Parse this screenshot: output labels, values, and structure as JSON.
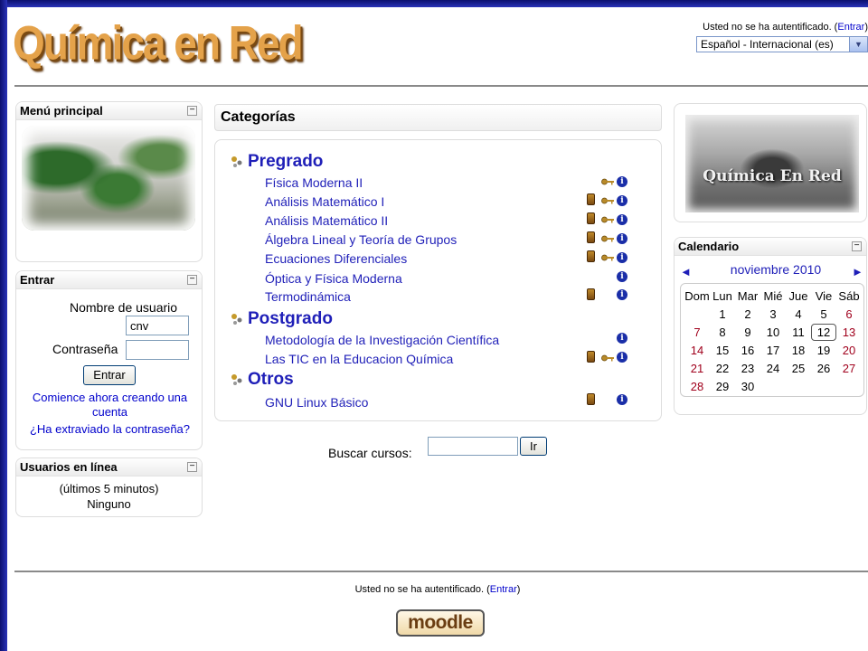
{
  "site": {
    "logo_text": "Química en Red"
  },
  "header": {
    "login_prefix": "Usted no se ha autentificado. (",
    "login_link": "Entrar",
    "login_suffix": ")",
    "language_selected": "Español - Internacional (es)"
  },
  "main_menu": {
    "title": "Menú principal"
  },
  "login_block": {
    "title": "Entrar",
    "username_label": "Nombre de usuario",
    "username_value": "cnv",
    "password_label": "Contraseña",
    "submit_label": "Entrar",
    "signup_link": "Comience ahora creando una cuenta",
    "forgot_link": "¿Ha extraviado la contraseña?"
  },
  "online_users": {
    "title": "Usuarios en línea",
    "period": "(últimos 5 minutos)",
    "value": "Ninguno"
  },
  "categories": {
    "heading": "Categorías",
    "groups": [
      {
        "name": "Pregrado",
        "courses": [
          {
            "name": "Física Moderna II",
            "guest": false,
            "key": true,
            "info": true
          },
          {
            "name": "Análisis Matemático I",
            "guest": true,
            "key": true,
            "info": true
          },
          {
            "name": "Análisis Matemático II",
            "guest": true,
            "key": true,
            "info": true
          },
          {
            "name": "Álgebra Lineal y Teoría de Grupos",
            "guest": true,
            "key": true,
            "info": true
          },
          {
            "name": "Ecuaciones Diferenciales",
            "guest": true,
            "key": true,
            "info": true
          },
          {
            "name": "Óptica y Física Moderna",
            "guest": false,
            "key": false,
            "info": true
          },
          {
            "name": "Termodinámica",
            "guest": true,
            "key": false,
            "info": true
          }
        ]
      },
      {
        "name": "Postgrado",
        "courses": [
          {
            "name": "Metodología de la Investigación Científica",
            "guest": false,
            "key": false,
            "info": true
          },
          {
            "name": "Las TIC en la Educacion Química",
            "guest": true,
            "key": true,
            "info": true
          }
        ]
      },
      {
        "name": "Otros",
        "courses": [
          {
            "name": "GNU Linux Básico",
            "guest": true,
            "key": false,
            "info": true
          }
        ]
      }
    ]
  },
  "search": {
    "label": "Buscar cursos:",
    "value": "",
    "button": "Ir"
  },
  "banner": {
    "text": "Química En Red"
  },
  "calendar": {
    "title": "Calendario",
    "month": "noviembre 2010",
    "prev": "◄",
    "next": "►",
    "weekdays": [
      "Dom",
      "Lun",
      "Mar",
      "Mié",
      "Jue",
      "Vie",
      "Sáb"
    ],
    "weeks": [
      [
        "",
        "1",
        "2",
        "3",
        "4",
        "5",
        "6"
      ],
      [
        "7",
        "8",
        "9",
        "10",
        "11",
        "12",
        "13"
      ],
      [
        "14",
        "15",
        "16",
        "17",
        "18",
        "19",
        "20"
      ],
      [
        "21",
        "22",
        "23",
        "24",
        "25",
        "26",
        "27"
      ],
      [
        "28",
        "29",
        "30",
        "",
        "",
        "",
        ""
      ]
    ],
    "today": "12"
  },
  "footer": {
    "login_prefix": "Usted no se ha autentificado. (",
    "login_link": "Entrar",
    "login_suffix": ")",
    "logo_text": "moodle"
  },
  "colors": {
    "frame": "#1a1f8a",
    "link": "#1f1fb8",
    "weekend": "#a0001c",
    "logo": "#e4a24a"
  }
}
